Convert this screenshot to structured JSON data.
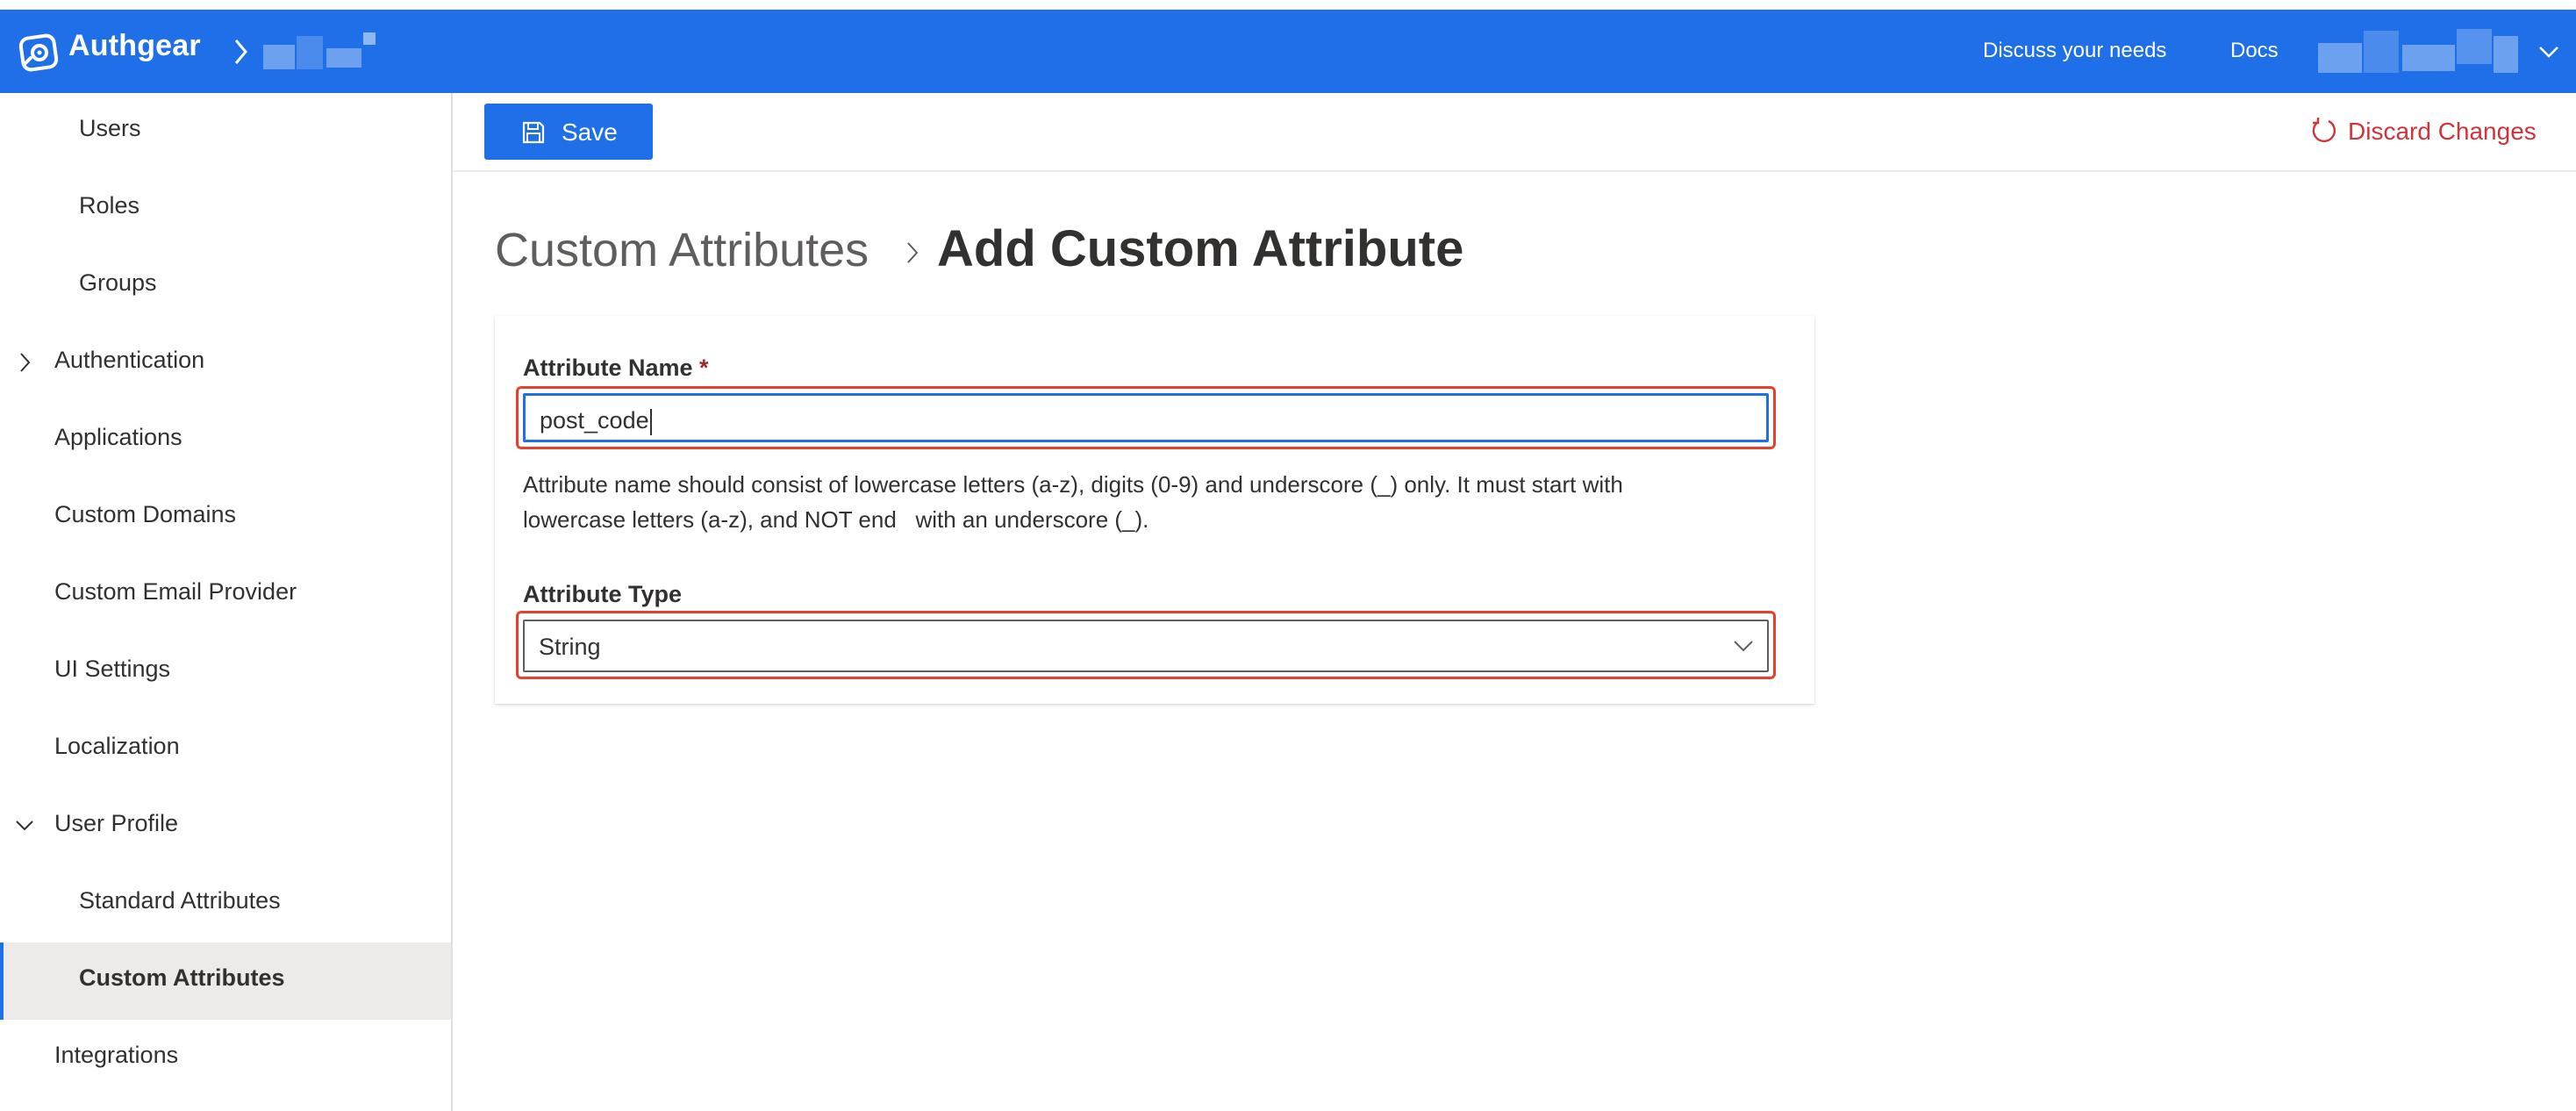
{
  "header": {
    "brand": "Authgear",
    "links": [
      "Discuss your needs",
      "Docs"
    ],
    "color": "#1e6fe8"
  },
  "sidebar": {
    "items": [
      {
        "label": "Users",
        "level": "sub"
      },
      {
        "label": "Roles",
        "level": "sub"
      },
      {
        "label": "Groups",
        "level": "sub"
      },
      {
        "label": "Authentication",
        "level": "top",
        "chevron": "right"
      },
      {
        "label": "Applications",
        "level": "top"
      },
      {
        "label": "Custom Domains",
        "level": "top"
      },
      {
        "label": "Custom Email Provider",
        "level": "top"
      },
      {
        "label": "UI Settings",
        "level": "top"
      },
      {
        "label": "Localization",
        "level": "top"
      },
      {
        "label": "User Profile",
        "level": "top",
        "chevron": "down"
      },
      {
        "label": "Standard Attributes",
        "level": "sub"
      },
      {
        "label": "Custom Attributes",
        "level": "sub",
        "selected": true
      },
      {
        "label": "Integrations",
        "level": "top"
      }
    ]
  },
  "commandbar": {
    "save_label": "Save",
    "discard_label": "Discard Changes",
    "discard_color": "#d13438"
  },
  "breadcrumb": {
    "parent": "Custom Attributes",
    "current": "Add Custom Attribute"
  },
  "form": {
    "name_label": "Attribute Name",
    "required_mark": "*",
    "name_value": "post_code",
    "helper_line1": "Attribute name should consist of lowercase letters (a-z), digits (0-9) and underscore (_) only. It must start with",
    "helper_line2": "lowercase letters (a-z), and NOT end   with an underscore (_).",
    "type_label": "Attribute Type",
    "type_value": "String",
    "highlight_color": "#e8402e"
  }
}
